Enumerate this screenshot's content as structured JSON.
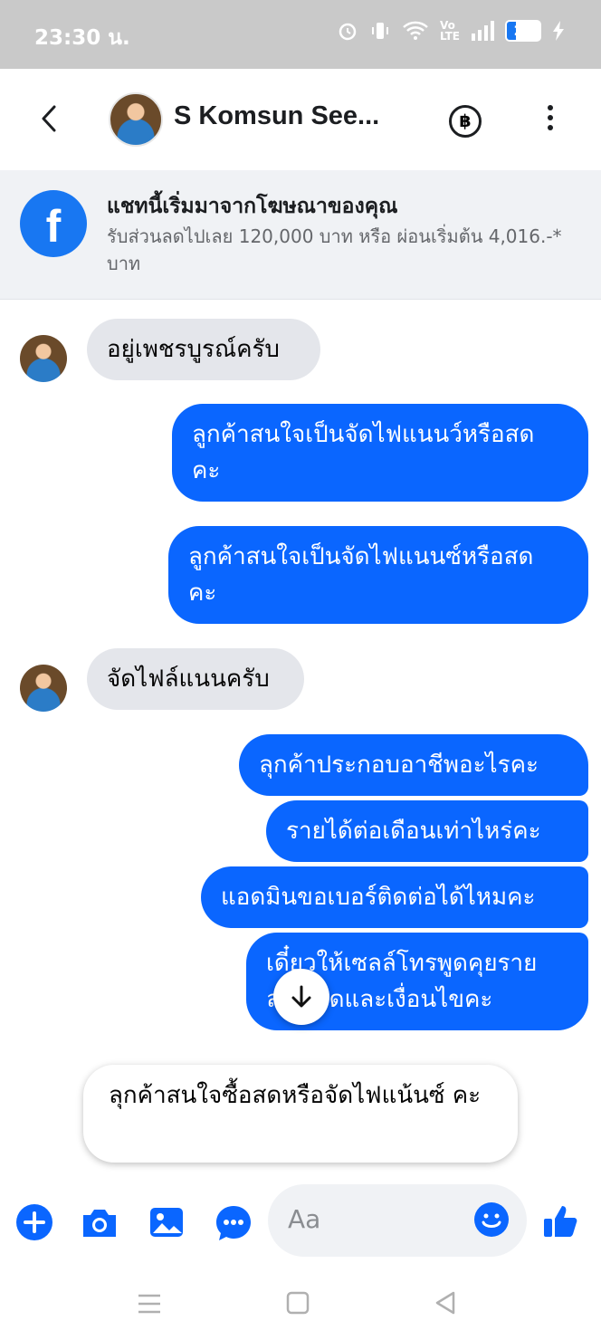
{
  "status_bar": {
    "time": "23:30 น.",
    "battery": "24"
  },
  "header": {
    "title": "S Komsun See..."
  },
  "ad_banner": {
    "title": "แชทนี้เริ่มมาจากโฆษณาของคุณ",
    "subtitle": "รับส่วนลดไปเลย 120,000 บาท หรือ ผ่อนเริ่มต้น 4,016.-* บาท"
  },
  "messages": [
    {
      "direction": "incoming",
      "text": "อยู่เพชรบูรณ์ครับ"
    },
    {
      "direction": "outgoing",
      "text": "ลูกค้าสนใจเป็นจัดไฟแนนว์หรือสด คะ"
    },
    {
      "direction": "outgoing",
      "text": "ลูกค้าสนใจเป็นจัดไฟแนนซ์หรือสด คะ"
    },
    {
      "direction": "incoming",
      "text": "จัดไฟล์แนนครับ"
    },
    {
      "direction": "outgoing",
      "text": "ลุกค้าประกอบอาชีพอะไรคะ"
    },
    {
      "direction": "outgoing",
      "text": "รายได้ต่อเดือนเท่าไหร่คะ"
    },
    {
      "direction": "outgoing",
      "text": "แอดมินขอเบอร์ติดต่อได้ไหมคะ"
    },
    {
      "direction": "outgoing",
      "text_line1": "เดี๋ยวให้เซลล์โทรพูดคุยราย",
      "text_line2": "ละเอียดและเงื่อนไขคะ"
    }
  ],
  "draft_message": "ลุกค้าสนใจซื้อสดหรือจัดไฟแน้นซ์ คะ",
  "composer": {
    "placeholder": "Aa",
    "icons": [
      "plus-icon",
      "camera-icon",
      "gallery-icon",
      "chat-bubble-icon",
      "emoji-icon",
      "thumbs-up-icon"
    ]
  },
  "colors": {
    "messenger_blue": "#0a66ff",
    "facebook_blue": "#1877f2",
    "incoming_bubble": "#e4e6eb"
  }
}
